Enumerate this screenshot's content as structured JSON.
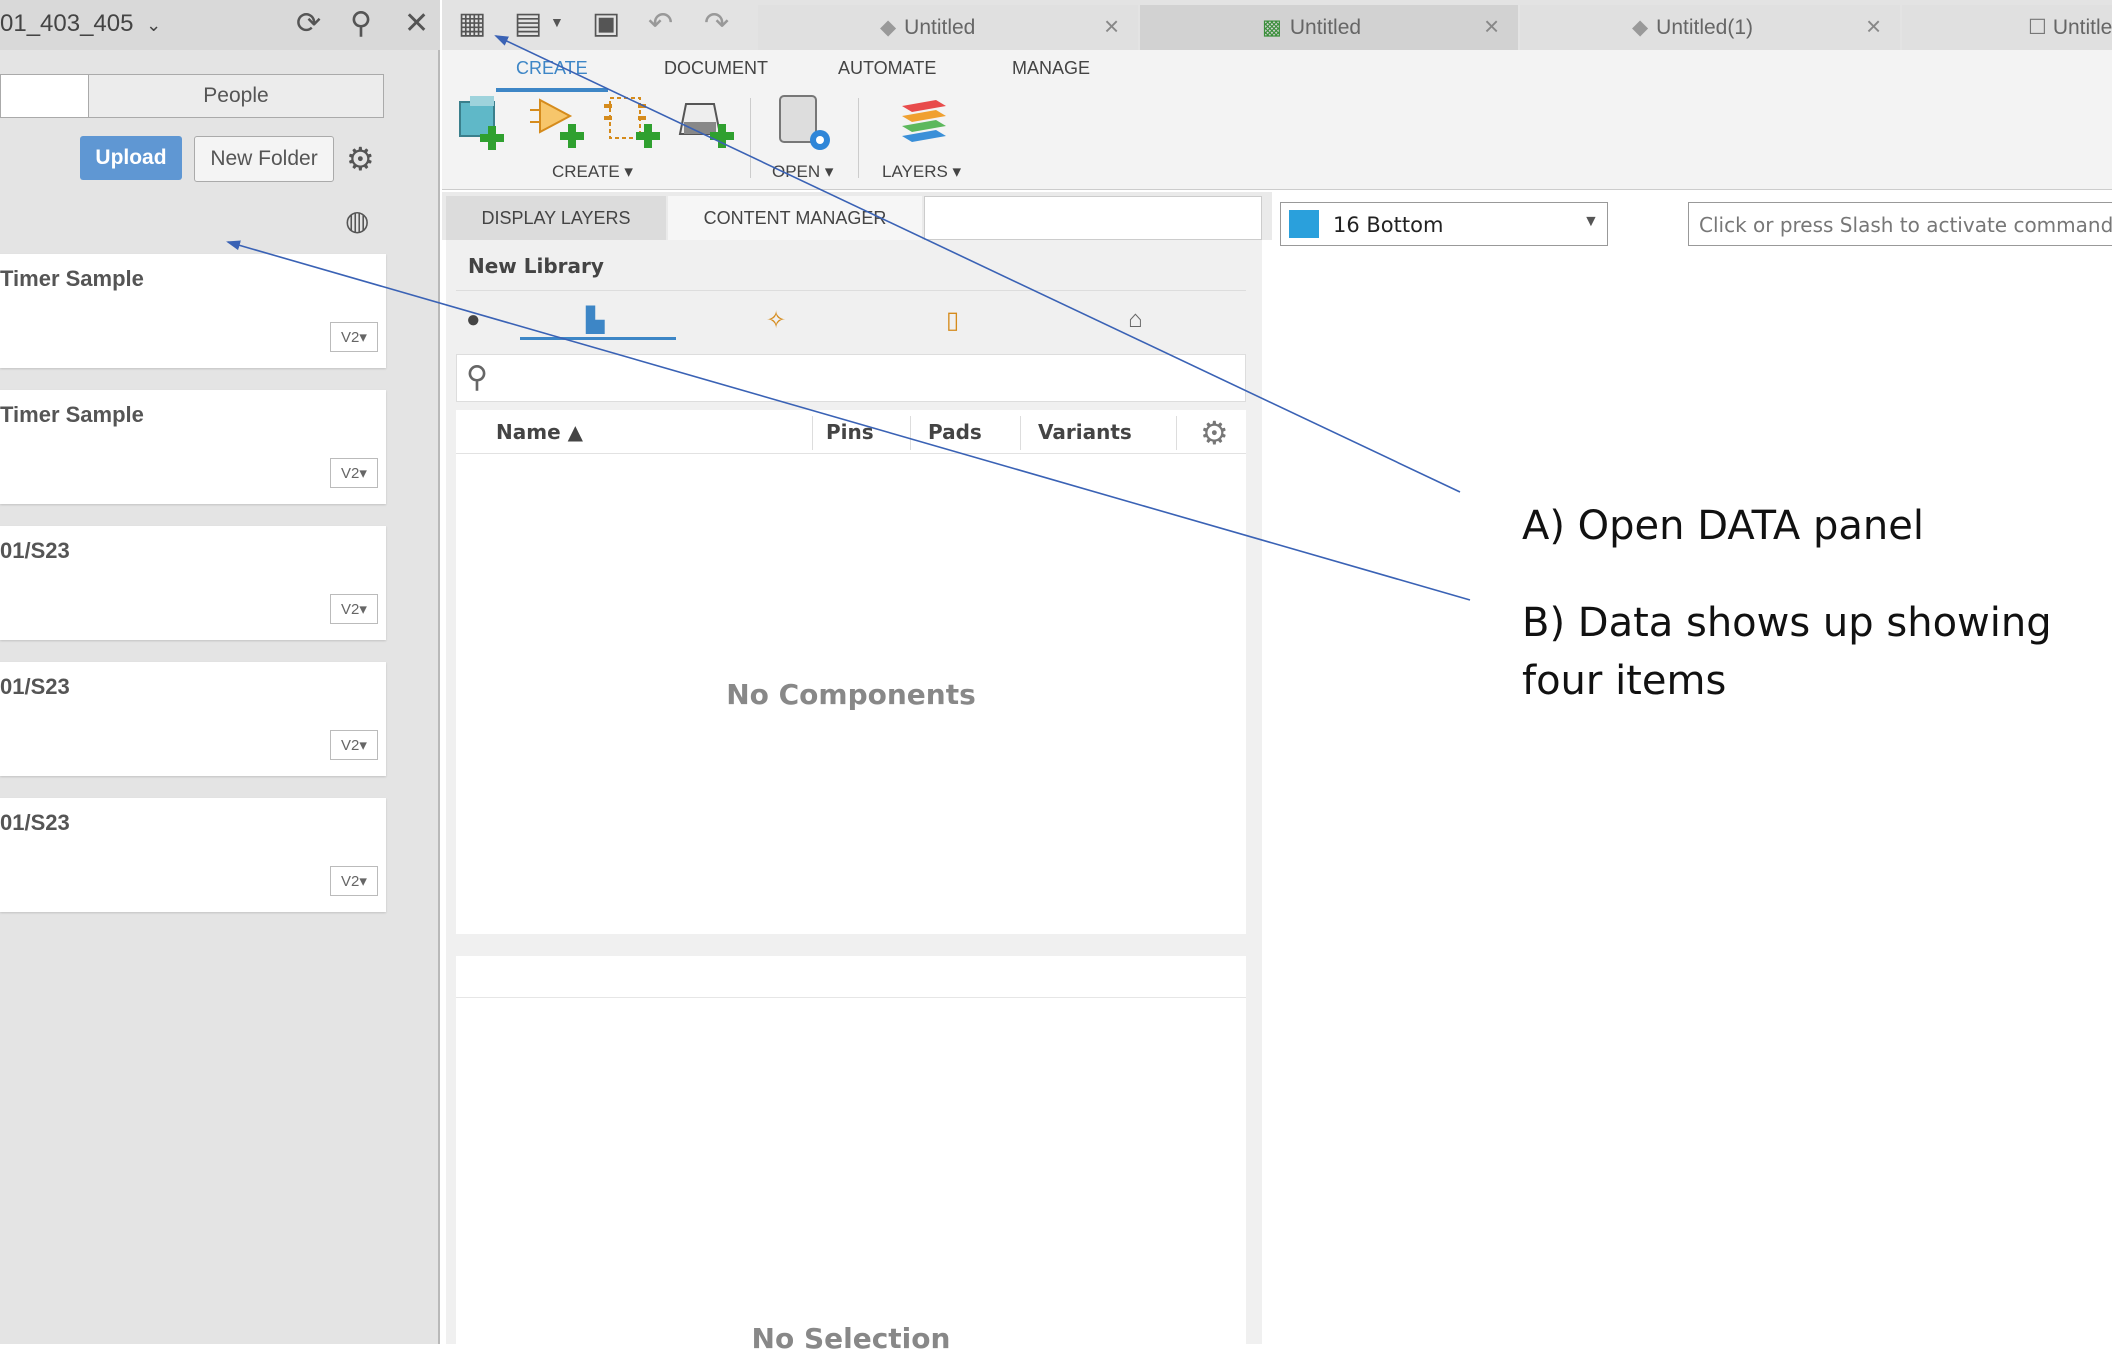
{
  "data_panel": {
    "project_name": "01_403_405",
    "people_tab": "People",
    "upload_label": "Upload",
    "new_folder_label": "New Folder",
    "items": [
      {
        "title": "Timer Sample",
        "version": "V2▾"
      },
      {
        "title": "Timer Sample",
        "version": "V2▾"
      },
      {
        "title": "01/S23",
        "version": "V2▾"
      },
      {
        "title": "01/S23",
        "version": "V2▾"
      },
      {
        "title": "01/S23",
        "version": "V2▾"
      }
    ]
  },
  "tabs": [
    {
      "label": "Untitled"
    },
    {
      "label": "Untitled"
    },
    {
      "label": "Untitled(1)"
    },
    {
      "label": "Untitle"
    }
  ],
  "ribbon": {
    "tabs": [
      "CREATE",
      "DOCUMENT",
      "AUTOMATE",
      "MANAGE"
    ],
    "create_group": "CREATE ▾",
    "open_group": "OPEN ▾",
    "layers_group": "LAYERS ▾"
  },
  "panel_tabs": {
    "display_layers": "DISPLAY LAYERS",
    "content_manager": "CONTENT MANAGER"
  },
  "layer_select": {
    "value": "16 Bottom",
    "color": "#2aa0dc"
  },
  "command_line": {
    "placeholder": "Click or press Slash to activate command line"
  },
  "content_manager": {
    "library": "New Library",
    "columns": [
      "Name ▲",
      "Pins",
      "Pads",
      "Variants"
    ],
    "empty_text": "No Components",
    "selection_text": "No Selection"
  },
  "annotations": {
    "a": "A) Open DATA panel",
    "b_line1": "B) Data shows up showing",
    "b_line2": "four items",
    "arrow_color": "#3a62b5"
  },
  "colors": {
    "accent": "#3d86c6",
    "upload": "#5f97d3"
  }
}
